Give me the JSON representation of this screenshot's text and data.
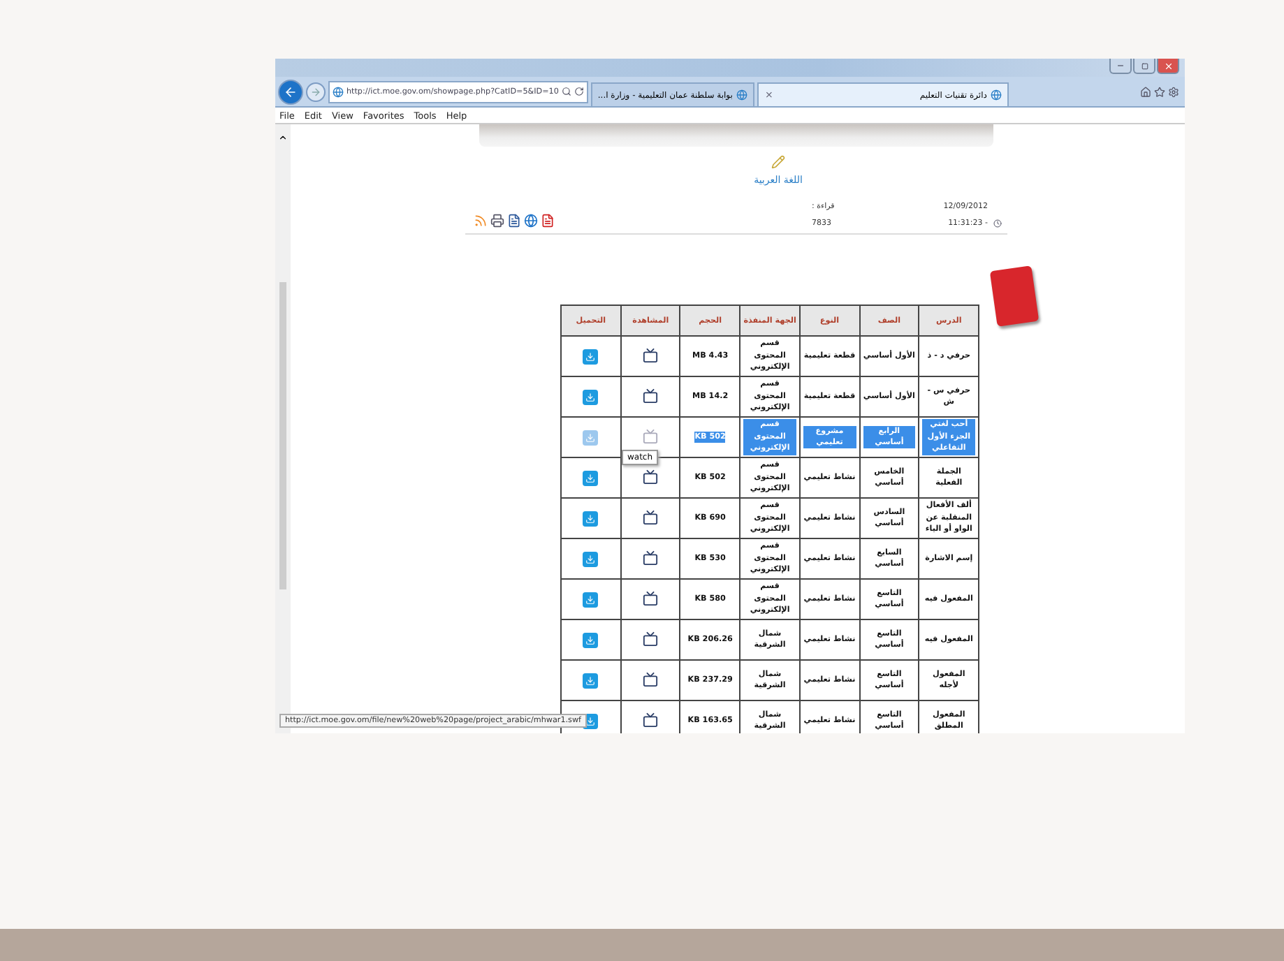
{
  "browser": {
    "address": "http://ict.moe.gov.om/showpage.php?CatID=5&ID=10",
    "tabs": [
      {
        "label": "دائرة تقنيات التعليم",
        "selected": true,
        "close": "×"
      },
      {
        "label": "بوابة سلطنة عمان التعليمية - وزارة ا...",
        "selected": false
      }
    ],
    "menu": {
      "file": "File",
      "edit": "Edit",
      "view": "View",
      "favorites": "Favorites",
      "tools": "Tools",
      "help": "Help"
    },
    "status_tooltip": "http://ict.moe.gov.om/file/new%20web%20page/project_arabic/mhwar1.swf"
  },
  "page": {
    "title": "اللغة العربية",
    "date": "12/09/2012",
    "time": "- 11:31:23",
    "reads_label": "قراءة :",
    "reads": "7833"
  },
  "table": {
    "columns": [
      "الدرس",
      "الصف",
      "النوع",
      "الجهة المنفذة",
      "الحجم",
      "المشاهدة",
      "التحميل"
    ],
    "rows": [
      {
        "cells": [
          "حرفي د - ذ",
          "الأول أساسي",
          "قطعة تعليمية",
          "قسم المحتوى الإلكتروني",
          "MB 4.43"
        ],
        "selected": false
      },
      {
        "cells": [
          "حرفي س - ش",
          "الأول أساسي",
          "قطعة تعليمية",
          "قسم المحتوى الإلكتروني",
          "MB 14.2"
        ],
        "selected": false
      },
      {
        "cells": [
          "أحب لغتي الجزء الأول التفاعلي",
          "الرابع أساسي",
          "مشروع تعليمي",
          "قسم المحتوى الإلكتروني",
          "KB 502"
        ],
        "selected": true
      },
      {
        "cells": [
          "الجملة الفعلية",
          "الخامس أساسي",
          "نشاط تعليمي",
          "قسم المحتوى الإلكتروني",
          "KB 502"
        ],
        "selected": false
      },
      {
        "cells": [
          "ألف الأفعال المنقلبة عن الواو أو الياء",
          "السادس أساسي",
          "نشاط تعليمي",
          "قسم المحتوى الإلكتروني",
          "KB 690"
        ],
        "selected": false
      },
      {
        "cells": [
          "إسم الاشارة",
          "السابع أساسي",
          "نشاط تعليمي",
          "قسم المحتوى الإلكتروني",
          "KB 530"
        ],
        "selected": false
      },
      {
        "cells": [
          "المفعول فيه",
          "التاسع أساسي",
          "نشاط تعليمي",
          "قسم المحتوى الإلكتروني",
          "KB 580"
        ],
        "selected": false
      },
      {
        "cells": [
          "المفعول فيه",
          "التاسع أساسي",
          "نشاط تعليمي",
          "شمال الشرقية",
          "KB 206.26"
        ],
        "selected": false
      },
      {
        "cells": [
          "المفعول لأجله",
          "التاسع أساسي",
          "نشاط تعليمي",
          "شمال الشرقية",
          "KB 237.29"
        ],
        "selected": false
      },
      {
        "cells": [
          "المفعول المطلق",
          "التاسع أساسي",
          "نشاط تعليمي",
          "شمال الشرقية",
          "KB 163.65"
        ],
        "selected": false
      }
    ],
    "tooltip": "watch"
  }
}
